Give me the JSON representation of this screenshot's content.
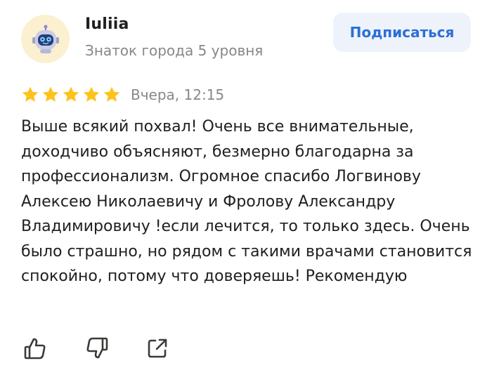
{
  "author": {
    "name": "Iuliia",
    "level": "Знаток города 5 уровня",
    "avatar_icon": "robot-avatar-icon"
  },
  "subscribe": {
    "label": "Подписаться"
  },
  "rating": {
    "stars": 5,
    "max_stars": 5,
    "date": "Вчера, 12:15"
  },
  "review": {
    "text": "Выше всякий похвал! Очень все внимательные, доходчиво объясняют, безмерно благодарна за профессионализм. Огромное спасибо Логвинову Алексею Николаевичу и Фролову Александру Владимировичу !если лечится, то только здесь. Очень было страшно, но рядом с такими врачами становится спокойно, потому что доверяешь! Рекомендую"
  },
  "actions": {
    "like_icon": "thumbs-up-icon",
    "dislike_icon": "thumbs-down-icon",
    "share_icon": "share-icon"
  },
  "colors": {
    "star": "#fec21c",
    "accent": "#2b6fd6",
    "button_bg": "#eef3fb",
    "muted_text": "#8a8784",
    "avatar_bg": "#fbf0cf"
  }
}
